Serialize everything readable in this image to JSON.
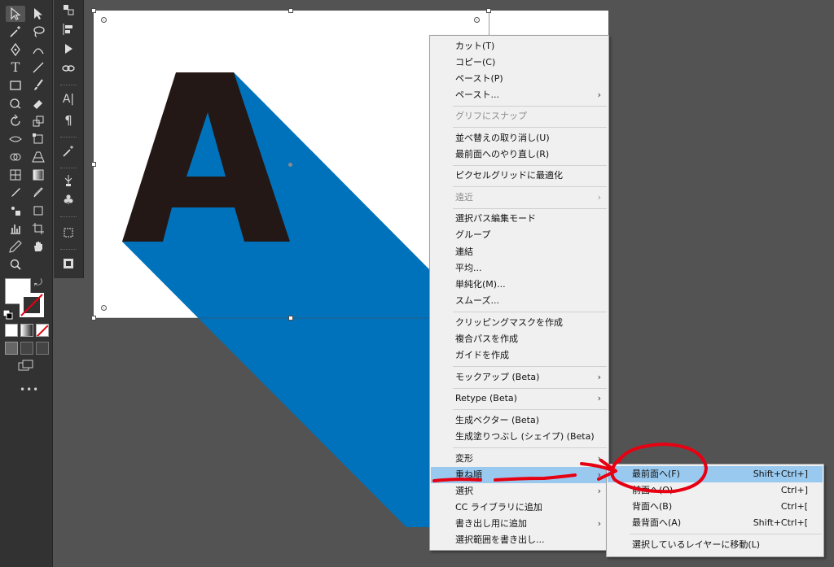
{
  "context_menu": {
    "items": [
      {
        "label": "カット(T)"
      },
      {
        "label": "コピー(C)"
      },
      {
        "label": "ペースト(P)"
      },
      {
        "label": "ペースト..."
      },
      {
        "label": "グリフにスナップ"
      },
      {
        "label": "並べ替えの取り消し(U)"
      },
      {
        "label": "最前面へのやり直し(R)"
      },
      {
        "label": "ピクセルグリッドに最適化"
      },
      {
        "label": "遠近"
      },
      {
        "label": "選択パス編集モード"
      },
      {
        "label": "グループ"
      },
      {
        "label": "連結"
      },
      {
        "label": "平均..."
      },
      {
        "label": "単純化(M)..."
      },
      {
        "label": "スムーズ..."
      },
      {
        "label": "クリッピングマスクを作成"
      },
      {
        "label": "複合パスを作成"
      },
      {
        "label": "ガイドを作成"
      },
      {
        "label": "モックアップ (Beta)"
      },
      {
        "label": "Retype (Beta)"
      },
      {
        "label": "生成ベクター (Beta)"
      },
      {
        "label": "生成塗りつぶし (シェイプ) (Beta)"
      },
      {
        "label": "変形"
      },
      {
        "label": "重ね順"
      },
      {
        "label": "選択"
      },
      {
        "label": "CC ライブラリに追加"
      },
      {
        "label": "書き出し用に追加"
      },
      {
        "label": "選択範囲を書き出し..."
      }
    ]
  },
  "submenu": {
    "items": [
      {
        "label": "最前面へ(F)",
        "shortcut": "Shift+Ctrl+]"
      },
      {
        "label": "前面へ(O)",
        "shortcut": "Ctrl+]"
      },
      {
        "label": "背面へ(B)",
        "shortcut": "Ctrl+["
      },
      {
        "label": "最背面へ(A)",
        "shortcut": "Shift+Ctrl+["
      },
      {
        "label": "選択しているレイヤーに移動(L)"
      }
    ]
  },
  "artwork": {
    "letter": "A",
    "letter_color": "#231815",
    "shadow_color": "#0072bc"
  },
  "colors": {
    "highlight": "#99c9ef",
    "annotation": "#e60012"
  }
}
